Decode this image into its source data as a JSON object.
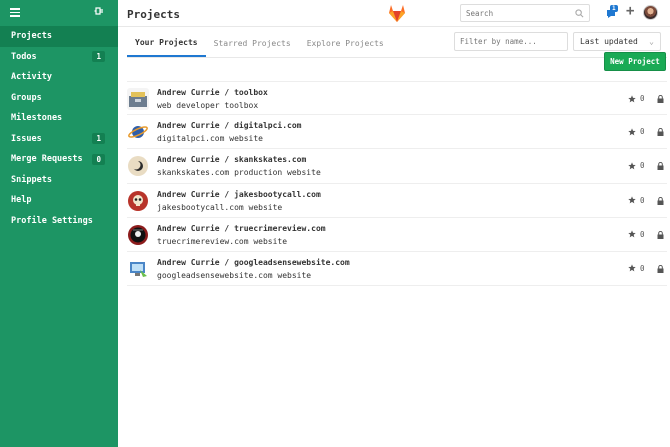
{
  "sidebar": {
    "items": [
      {
        "label": "Projects",
        "badge": null,
        "active": true,
        "key": "projects"
      },
      {
        "label": "Todos",
        "badge": "1",
        "active": false,
        "key": "todos"
      },
      {
        "label": "Activity",
        "badge": null,
        "active": false,
        "key": "activity"
      },
      {
        "label": "Groups",
        "badge": null,
        "active": false,
        "key": "groups"
      },
      {
        "label": "Milestones",
        "badge": null,
        "active": false,
        "key": "milestones"
      },
      {
        "label": "Issues",
        "badge": "1",
        "active": false,
        "key": "issues"
      },
      {
        "label": "Merge Requests",
        "badge": "0",
        "active": false,
        "key": "merge-requests"
      },
      {
        "label": "Snippets",
        "badge": null,
        "active": false,
        "key": "snippets"
      },
      {
        "label": "Help",
        "badge": null,
        "active": false,
        "key": "help"
      },
      {
        "label": "Profile Settings",
        "badge": null,
        "active": false,
        "key": "profile-settings"
      }
    ]
  },
  "header": {
    "title": "Projects",
    "search_placeholder": "Search",
    "notification_count": "1"
  },
  "tabs": [
    {
      "label": "Your Projects",
      "active": true
    },
    {
      "label": "Starred Projects",
      "active": false
    },
    {
      "label": "Explore Projects",
      "active": false
    }
  ],
  "filter": {
    "placeholder": "Filter by name..."
  },
  "sort": {
    "selected": "Last updated"
  },
  "new_project_label": "New Project",
  "projects": [
    {
      "name": "Andrew Currie / toolbox",
      "description": "web developer toolbox",
      "stars": "0",
      "avatar": "toolbox-icon"
    },
    {
      "name": "Andrew Currie / digitalpci.com",
      "description": "digitalpci.com website",
      "stars": "0",
      "avatar": "planet-icon"
    },
    {
      "name": "Andrew Currie / skankskates.com",
      "description": "skankskates.com production website",
      "stars": "0",
      "avatar": "moon-icon"
    },
    {
      "name": "Andrew Currie / jakesbootycall.com",
      "description": "jakesbootycall.com website",
      "stars": "0",
      "avatar": "skull-icon"
    },
    {
      "name": "Andrew Currie / truecrimereview.com",
      "description": "truecrimereview.com website",
      "stars": "0",
      "avatar": "detective-icon"
    },
    {
      "name": "Andrew Currie / googleadsensewebsite.com",
      "description": "googleadsensewebsite.com website",
      "stars": "0",
      "avatar": "monitor-icon"
    }
  ],
  "colors": {
    "sidebar_bg": "#1d9564",
    "sidebar_active": "#138052",
    "primary_button": "#1aaa55",
    "active_tab_underline": "#1f78d1"
  }
}
